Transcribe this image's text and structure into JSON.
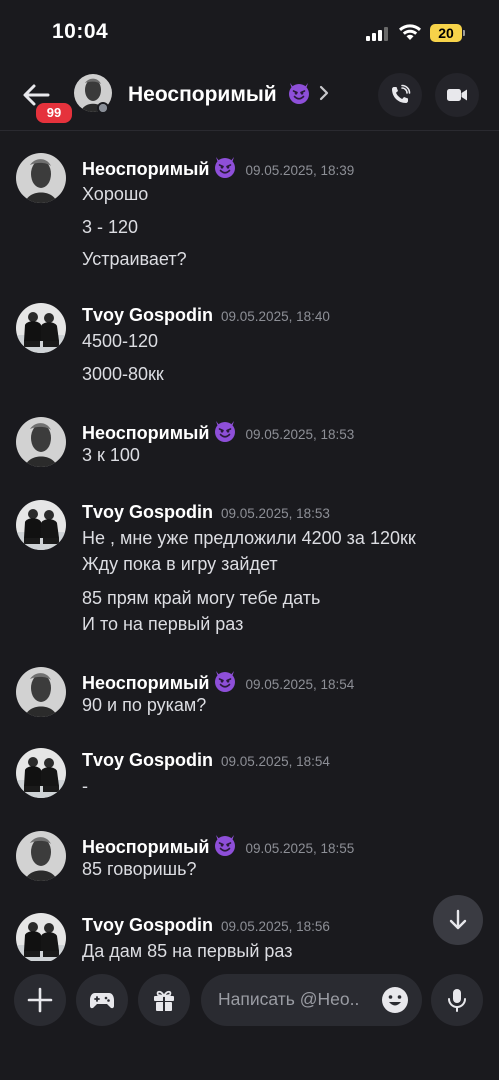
{
  "status_bar": {
    "time": "10:04",
    "battery": "20"
  },
  "header": {
    "unread_badge": "99",
    "title": "Неоспоримый",
    "title_emoji": "smiling-devil"
  },
  "messages": [
    {
      "author": "Неоспоримый",
      "avatar": "avatar-neosporimy",
      "emoji": true,
      "time": "09.05.2025, 18:39",
      "lines": [
        "Хорошо",
        "3 - 120",
        "Устраивает?"
      ]
    },
    {
      "author": "Tvoy Gospodin",
      "avatar": "avatar-tvoy-gospodin",
      "emoji": false,
      "time": "09.05.2025, 18:40",
      "lines": [
        "4500-120",
        "3000-80кк"
      ]
    },
    {
      "author": "Неоспоримый",
      "avatar": "avatar-neosporimy",
      "emoji": true,
      "time": "09.05.2025, 18:53",
      "lines": [
        "3 к 100"
      ]
    },
    {
      "author": "Tvoy Gospodin",
      "avatar": "avatar-tvoy-gospodin",
      "emoji": false,
      "time": "09.05.2025, 18:53",
      "lines": [
        "Не , мне уже предложили 4200 за 120кк",
        "Жду пока в игру зайдет",
        "85 прям край могу тебе дать",
        "И то на первый раз"
      ]
    },
    {
      "author": "Неоспоримый",
      "avatar": "avatar-neosporimy",
      "emoji": true,
      "time": "09.05.2025, 18:54",
      "lines": [
        "90 и по рукам?"
      ]
    },
    {
      "author": "Tvoy Gospodin",
      "avatar": "avatar-tvoy-gospodin",
      "emoji": false,
      "time": "09.05.2025, 18:54",
      "lines": [
        "-"
      ]
    },
    {
      "author": "Неоспоримый",
      "avatar": "avatar-neosporimy",
      "emoji": true,
      "time": "09.05.2025, 18:55",
      "lines": [
        "85 говоришь?"
      ]
    },
    {
      "author": "Tvoy Gospodin",
      "avatar": "avatar-tvoy-gospodin",
      "emoji": false,
      "time": "09.05.2025, 18:56",
      "lines": [
        "Да дам 85 на первый раз"
      ]
    }
  ],
  "composer": {
    "placeholder": "Написать @Нео.."
  },
  "colors": {
    "background": "#1a1a1e",
    "badge": "#e5323c",
    "emoji_purple": "#8e4fd9",
    "button": "#2a2b31"
  }
}
